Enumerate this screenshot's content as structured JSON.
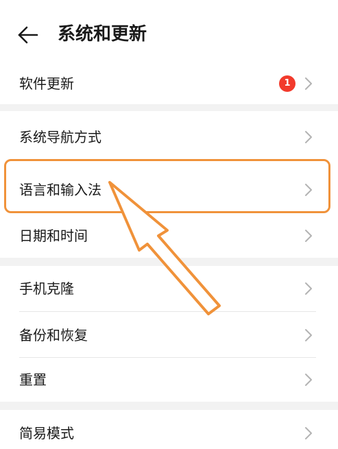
{
  "header": {
    "title": "系统和更新",
    "back_icon": "arrow-left-icon"
  },
  "colors": {
    "badge": "#f23a2c",
    "highlight": "#f0923a",
    "section_gap": "#f2f2f2",
    "chevron": "#b3b3b3"
  },
  "sections": [
    {
      "items": [
        {
          "label": "软件更新",
          "badge": "1"
        }
      ]
    },
    {
      "items": [
        {
          "label": "系统导航方式"
        },
        {
          "label": "语言和输入法",
          "highlighted": true
        },
        {
          "label": "日期和时间"
        }
      ]
    },
    {
      "items": [
        {
          "label": "手机克隆"
        },
        {
          "label": "备份和恢复"
        },
        {
          "label": "重置"
        }
      ]
    },
    {
      "items": [
        {
          "label": "简易模式"
        }
      ]
    }
  ],
  "annotation": {
    "highlight_target": "语言和输入法",
    "pointer_icon": "orange-hollow-arrow-icon"
  }
}
